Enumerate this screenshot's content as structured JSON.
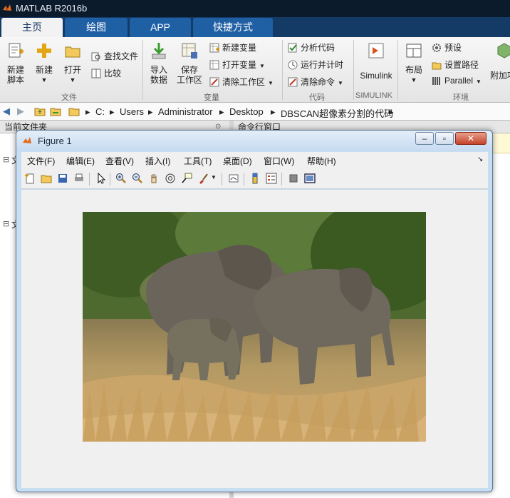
{
  "app": {
    "title": "MATLAB R2016b"
  },
  "tabs": [
    {
      "label": "主页",
      "active": true
    },
    {
      "label": "绘图",
      "active": false
    },
    {
      "label": "APP",
      "active": false
    },
    {
      "label": "快捷方式",
      "active": false
    }
  ],
  "ribbon": {
    "file": {
      "new_script": [
        "新建",
        "脚本"
      ],
      "new": "新建",
      "open": "打开",
      "find_files": "查找文件",
      "compare": "比较",
      "group": "文件"
    },
    "variable": {
      "import_data": [
        "导入",
        "数据"
      ],
      "save_workspace": [
        "保存",
        "工作区"
      ],
      "new_variable": "新建变量",
      "open_variable": "打开变量",
      "clear_workspace": "清除工作区",
      "group": "变量"
    },
    "code": {
      "analyze": "分析代码",
      "run_time": "运行并计时",
      "clear_commands": "清除命令",
      "group": "代码"
    },
    "simulink": {
      "label": "Simulink",
      "group": "SIMULINK"
    },
    "environment": {
      "layout": "布局",
      "preferences": "预设",
      "set_path": "设置路径",
      "parallel": "Parallel",
      "addons": "附加项",
      "group": "环境"
    }
  },
  "address": {
    "path": [
      "C:",
      "Users",
      "Administrator",
      "Desktop",
      "DBSCAN超像素分割的代码"
    ]
  },
  "panes": {
    "current_folder": "当前文件夹",
    "command_window": "命令行窗口",
    "collapsed_1": "文",
    "collapsed_2": "文"
  },
  "figure": {
    "title": "Figure 1",
    "menu": [
      "文件(F)",
      "编辑(E)",
      "查看(V)",
      "插入(I)",
      "工具(T)",
      "桌面(D)",
      "窗口(W)",
      "帮助(H)"
    ],
    "toolbar_icons": [
      "new-figure-icon",
      "open-icon",
      "save-icon",
      "print-icon",
      "pointer-icon",
      "zoom-in-icon",
      "zoom-out-icon",
      "pan-icon",
      "rotate-icon",
      "data-cursor-icon",
      "brush-icon",
      "link-plot-icon",
      "colorbar-icon",
      "legend-icon",
      "hide-plot-tools-icon",
      "show-plot-tools-icon"
    ]
  },
  "colors": {
    "accent": "#1f5fa4",
    "titlebar": "#0c1b2c"
  }
}
